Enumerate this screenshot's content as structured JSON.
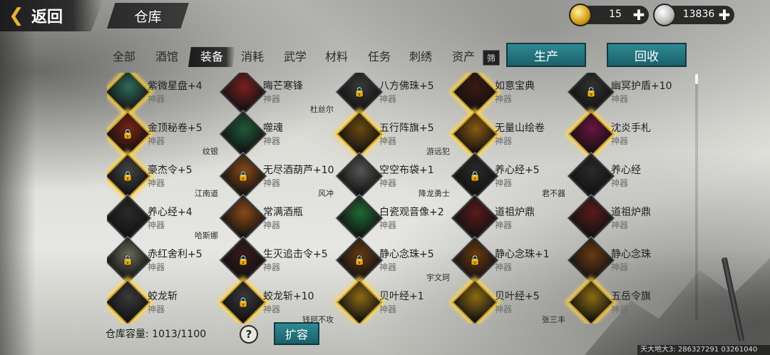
{
  "header": {
    "back_label": "返回",
    "title": "仓库",
    "gold": "15",
    "silver": "13836",
    "back_icon": "chevron-left-icon"
  },
  "tabs": [
    {
      "label": "全部",
      "active": false
    },
    {
      "label": "酒馆",
      "active": false
    },
    {
      "label": "装备",
      "active": true
    },
    {
      "label": "消耗",
      "active": false
    },
    {
      "label": "武学",
      "active": false
    },
    {
      "label": "材料",
      "active": false
    },
    {
      "label": "任务",
      "active": false
    },
    {
      "label": "刺绣",
      "active": false
    },
    {
      "label": "资产",
      "active": false
    }
  ],
  "filter_label": "筛",
  "buttons": {
    "produce": "生产",
    "recycle": "回收",
    "expand": "扩容",
    "help": "?"
  },
  "capacity": {
    "label": "仓库容量:",
    "value": "1013/1100"
  },
  "items": [
    {
      "name": "紫微星盘+4",
      "type": "神器",
      "owner": "",
      "locked": false,
      "color": "#2f6b5a"
    },
    {
      "name": "晦芒寒锋",
      "type": "神器",
      "owner": "杜丝尔",
      "locked": false,
      "color": "#7a1f1f"
    },
    {
      "name": "八方佛珠+5",
      "type": "神器",
      "owner": "",
      "locked": true,
      "color": "#3a3a3a"
    },
    {
      "name": "如意宝典",
      "type": "神器",
      "owner": "",
      "locked": false,
      "color": "#3b1a12"
    },
    {
      "name": "幽冥护盾+10",
      "type": "神器",
      "owner": "",
      "locked": true,
      "color": "#333333"
    },
    {
      "name": "金顶秘卷+5",
      "type": "神器",
      "owner": "纹银",
      "locked": true,
      "color": "#7a2412"
    },
    {
      "name": "噬魂",
      "type": "神器",
      "owner": "",
      "locked": false,
      "color": "#1f5a3a"
    },
    {
      "name": "五行阵旗+5",
      "type": "神器",
      "owner": "游远犯",
      "locked": false,
      "color": "#6b4a10"
    },
    {
      "name": "无量山绘卷",
      "type": "神器",
      "owner": "",
      "locked": false,
      "color": "#8a5a12"
    },
    {
      "name": "沈炎手札",
      "type": "神器",
      "owner": "",
      "locked": false,
      "color": "#6a1440"
    },
    {
      "name": "豪杰令+5",
      "type": "神器",
      "owner": "江南道",
      "locked": true,
      "color": "#444444"
    },
    {
      "name": "无尽酒葫芦+10",
      "type": "神器",
      "owner": "风冲",
      "locked": true,
      "color": "#8a4a18"
    },
    {
      "name": "空空布袋+1",
      "type": "神器",
      "owner": "降龙勇士",
      "locked": false,
      "color": "#555555"
    },
    {
      "name": "养心经+5",
      "type": "神器",
      "owner": "君不器",
      "locked": true,
      "color": "#2a2a2a"
    },
    {
      "name": "养心经",
      "type": "神器",
      "owner": "",
      "locked": false,
      "color": "#2a2a2a"
    },
    {
      "name": "养心经+4",
      "type": "神器",
      "owner": "哈斯娜",
      "locked": false,
      "color": "#2a2a2a"
    },
    {
      "name": "常满酒瓶",
      "type": "神器",
      "owner": "",
      "locked": false,
      "color": "#8a4a18"
    },
    {
      "name": "白瓷观音像+2",
      "type": "神器",
      "owner": "",
      "locked": false,
      "color": "#1f6a34"
    },
    {
      "name": "道祖炉鼎",
      "type": "神器",
      "owner": "",
      "locked": false,
      "color": "#5a1a1a"
    },
    {
      "name": "道祖炉鼎",
      "type": "神器",
      "owner": "",
      "locked": false,
      "color": "#5a1a1a"
    },
    {
      "name": "赤红舍利+5",
      "type": "神器",
      "owner": "",
      "locked": true,
      "color": "#6a6a5a"
    },
    {
      "name": "生灭追击令+5",
      "type": "神器",
      "owner": "",
      "locked": true,
      "color": "#3a1a1a"
    },
    {
      "name": "静心念珠+5",
      "type": "神器",
      "owner": "宇文珂",
      "locked": true,
      "color": "#6a3a10"
    },
    {
      "name": "静心念珠+1",
      "type": "神器",
      "owner": "",
      "locked": true,
      "color": "#6a3a10"
    },
    {
      "name": "静心念珠",
      "type": "神器",
      "owner": "",
      "locked": false,
      "color": "#6a3a10"
    },
    {
      "name": "蛟龙斩",
      "type": "神器",
      "owner": "",
      "locked": false,
      "color": "#3a3a3a"
    },
    {
      "name": "蛟龙斩+10",
      "type": "神器",
      "owner": "钱珂不攻",
      "locked": true,
      "color": "#3a3a3a"
    },
    {
      "name": "贝叶经+1",
      "type": "神器",
      "owner": "",
      "locked": false,
      "color": "#8a6a12"
    },
    {
      "name": "贝叶经+5",
      "type": "神器",
      "owner": "张三丰",
      "locked": false,
      "color": "#8a6a12"
    },
    {
      "name": "五岳令旗",
      "type": "神器",
      "owner": "",
      "locked": false,
      "color": "#8a6a12"
    }
  ],
  "watermark": "天大地大3: 286327291  03261040"
}
